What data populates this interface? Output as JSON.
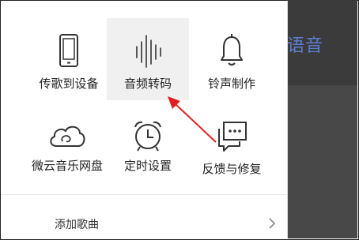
{
  "background": {
    "partial_text": "语音",
    "colors": {
      "dark": "#3b3b3b",
      "accent": "#5a7fd0"
    }
  },
  "menu": {
    "tiles": [
      {
        "label": "传歌到设备",
        "icon": "phone-icon"
      },
      {
        "label": "音频转码",
        "icon": "waveform-icon",
        "active": true
      },
      {
        "label": "铃声制作",
        "icon": "bell-icon"
      },
      {
        "label": "微云音乐网盘",
        "icon": "cloud-icon"
      },
      {
        "label": "定时设置",
        "icon": "alarm-clock-icon"
      },
      {
        "label": "反馈与修复",
        "icon": "feedback-icon"
      }
    ],
    "bottom_item": {
      "label": "添加歌曲",
      "icon": "chevron-right-icon"
    }
  },
  "annotation": {
    "color": "#e02020"
  }
}
